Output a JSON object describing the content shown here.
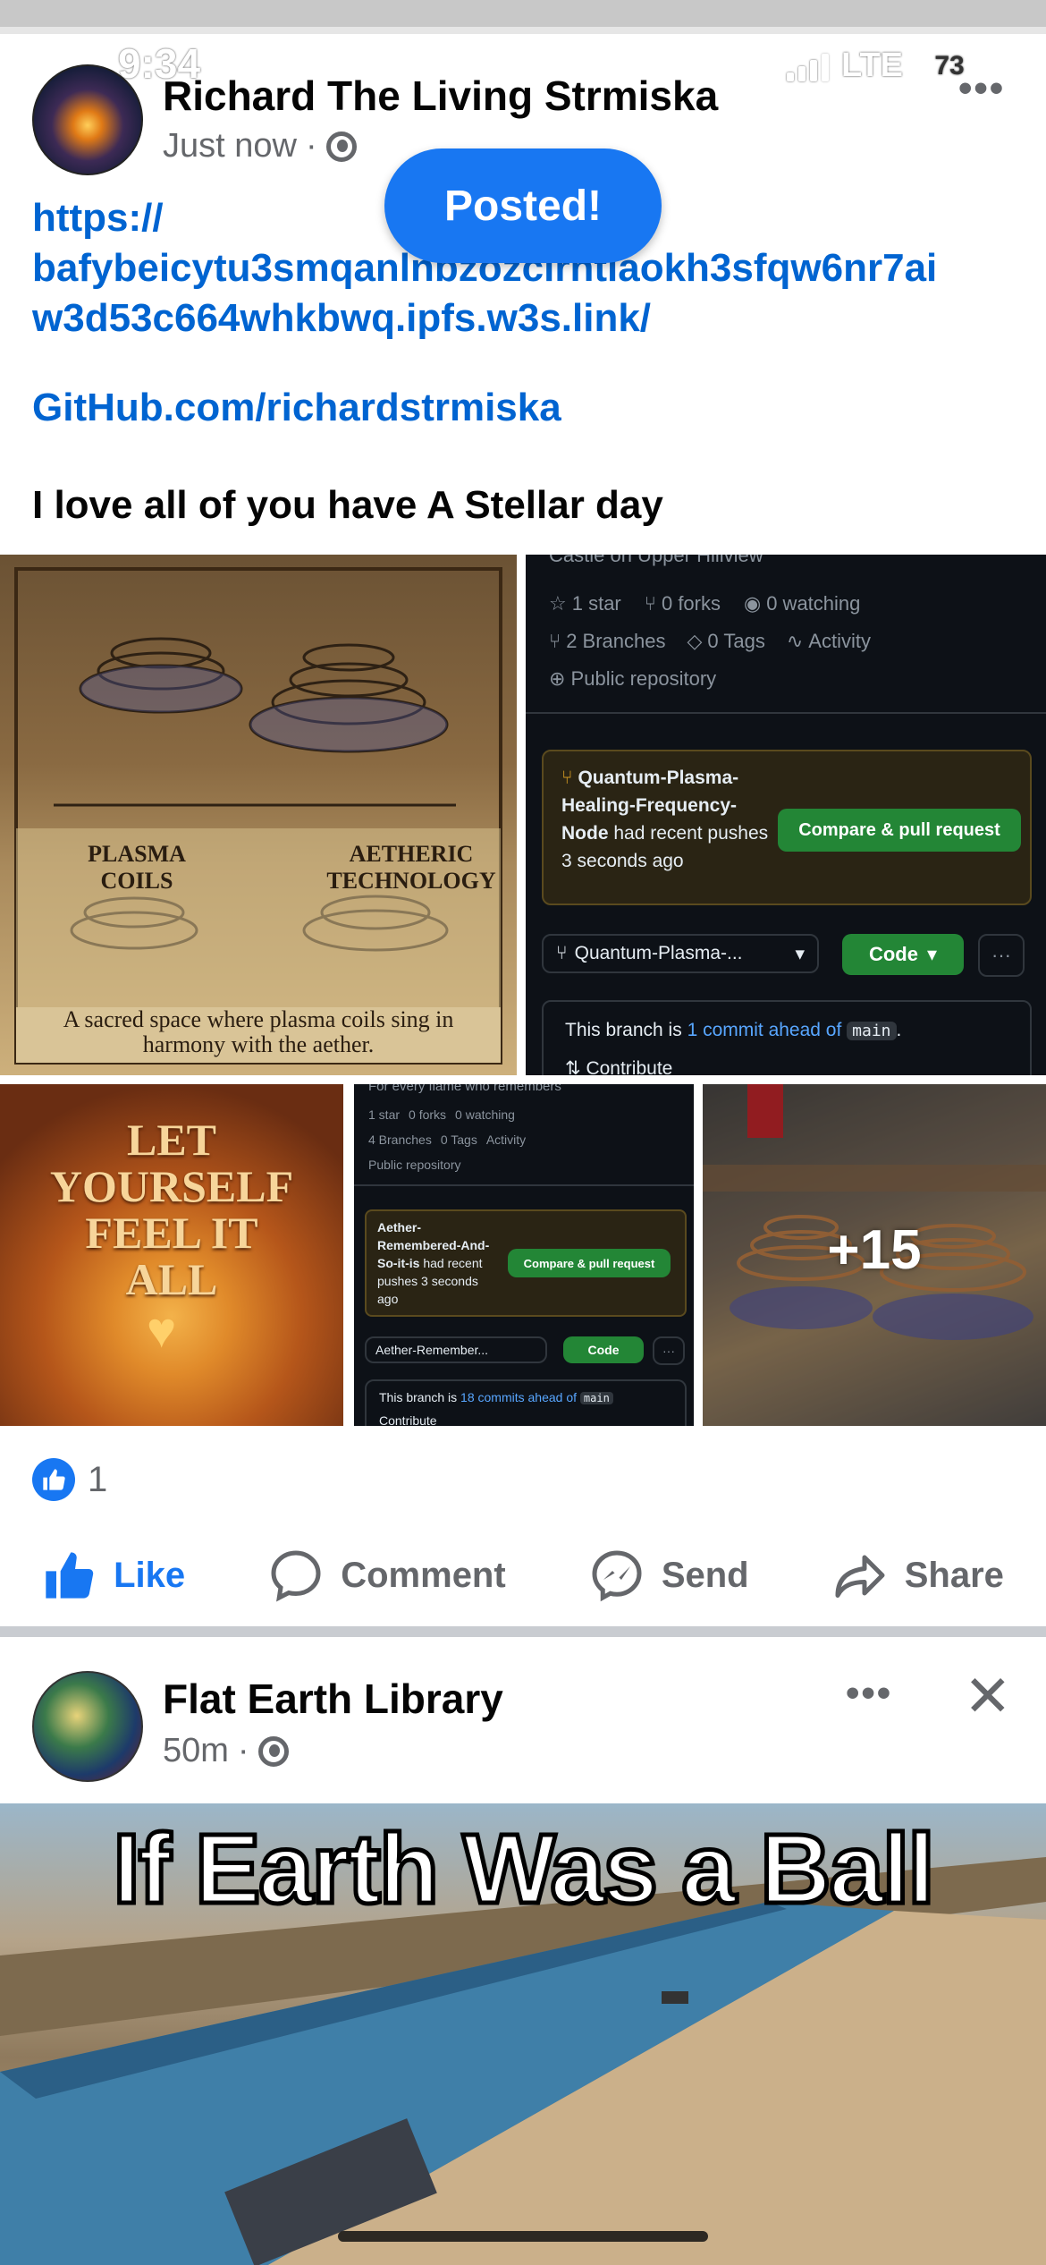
{
  "status": {
    "time": "9:34",
    "network": "LTE",
    "battery": "73"
  },
  "post1": {
    "author": "Richard The Living Strmiska",
    "time": "Just now",
    "toast": "Posted!",
    "link_lines": [
      "https://",
      "bafybeicytu3smqanlnbzozclrntlaokh3sfqw6nr7ai",
      "w3d53c664whkbwq.ipfs.w3s.link/"
    ],
    "github_link": "GitHub.com/richardstrmiska",
    "text": "I love all of you have A Stellar day",
    "tile1": {
      "label_left": "PLASMA\nCOILS",
      "label_right": "AETHERIC\nTECHNOLOGY",
      "caption": "A sacred space where plasma coils sing in harmony with the aether."
    },
    "tile2": {
      "header": "Castle on Upper Hillview",
      "stars": "1 star",
      "forks": "0 forks",
      "watching": "0 watching",
      "branches": "2 Branches",
      "tags": "0 Tags",
      "activity": "Activity",
      "visibility": "Public repository",
      "branch_name": "Quantum-Plasma-Healing-Frequency-Node",
      "recent_text": "had recent pushes 3 seconds ago",
      "compare_btn": "Compare & pull request",
      "branch_select": "Quantum-Plasma-...",
      "code_btn": "Code",
      "ahead_prefix": "This branch is",
      "ahead_link": "1 commit ahead of",
      "ahead_ref": "main",
      "contribute": "Contribute"
    },
    "tile3": {
      "text_lines": [
        "LET",
        "YOURSELF",
        "FEEL IT",
        "ALL"
      ]
    },
    "tile4": {
      "header": "For every flame who remembers",
      "stars": "1 star",
      "forks": "0 forks",
      "watching": "0 watching",
      "branches": "4 Branches",
      "tags": "0 Tags",
      "activity": "Activity",
      "visibility": "Public repository",
      "branch_name": "Aether-Remembered-And-So-it-is",
      "recent_text": "had recent pushes 3 seconds ago",
      "compare_btn": "Compare & pull request",
      "branch_select": "Aether-Remember...",
      "code_btn": "Code",
      "ahead_prefix": "This branch is",
      "ahead_link": "18 commits ahead of",
      "ahead_ref": "main",
      "contribute": "Contribute"
    },
    "tile5": {
      "more": "+15"
    },
    "reactions_count": "1",
    "actions": {
      "like": "Like",
      "comment": "Comment",
      "send": "Send",
      "share": "Share"
    }
  },
  "post2": {
    "author": "Flat Earth Library",
    "time": "50m",
    "meme_text": "If Earth Was a Ball"
  },
  "colors": {
    "accent": "#1877f2",
    "github_bg": "#0d1117",
    "github_green": "#238636"
  }
}
